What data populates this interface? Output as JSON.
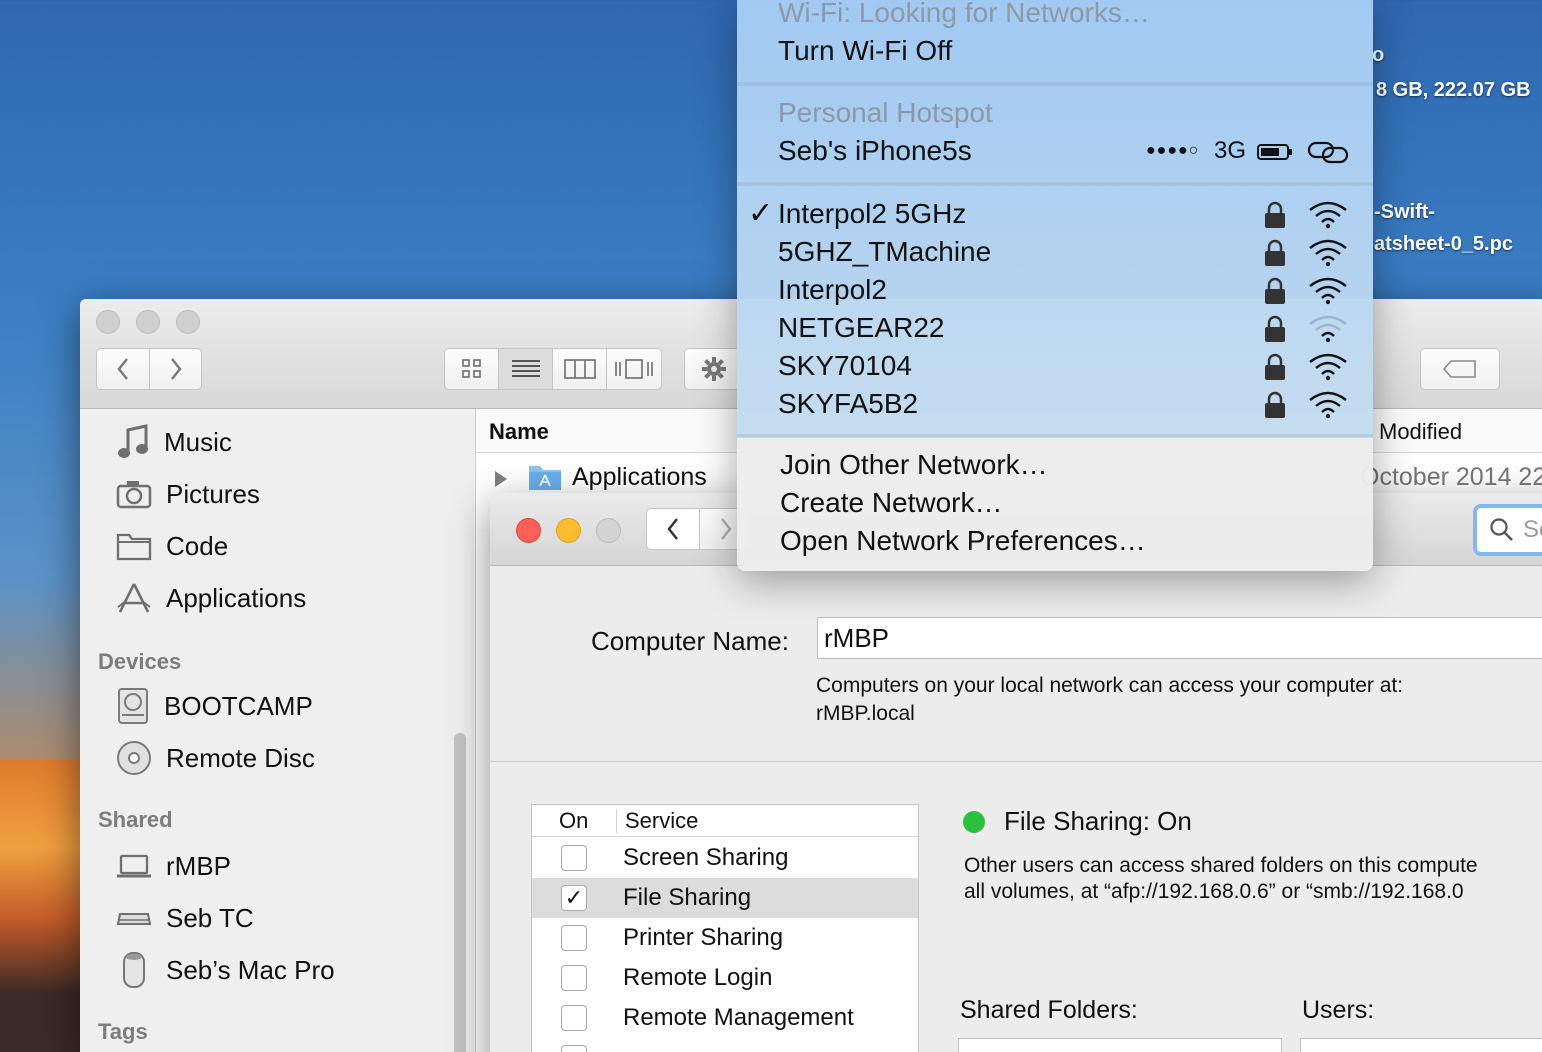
{
  "desktop": {
    "drive_name_fragment": "o",
    "drive_size_fragment": "8 GB, 222.07 GB",
    "file_name_line1": "-Swift-",
    "file_name_line2": "atsheet-0_5.pc"
  },
  "finder": {
    "sidebar": {
      "favorites": [
        {
          "label": "Music",
          "icon": "music-note-icon"
        },
        {
          "label": "Pictures",
          "icon": "camera-icon"
        },
        {
          "label": "Code",
          "icon": "folder-icon"
        },
        {
          "label": "Applications",
          "icon": "applications-icon"
        }
      ],
      "devices_heading": "Devices",
      "devices": [
        {
          "label": "BOOTCAMP",
          "icon": "hard-drive-icon"
        },
        {
          "label": "Remote Disc",
          "icon": "disc-icon"
        }
      ],
      "shared_heading": "Shared",
      "shared": [
        {
          "label": "rMBP",
          "icon": "laptop-icon"
        },
        {
          "label": "Seb TC",
          "icon": "time-capsule-icon"
        },
        {
          "label": "Seb’s Mac Pro",
          "icon": "mac-pro-icon"
        }
      ],
      "tags_heading": "Tags"
    },
    "columns": {
      "name": "Name",
      "date_modified": "Modified"
    },
    "rows": [
      {
        "name": "Applications",
        "date_fragment": "October 2014 22"
      }
    ]
  },
  "sharing": {
    "search_placeholder_fragment": "Se",
    "computer_name_label": "Computer Name:",
    "computer_name_value": "rMBP",
    "access_note": "Computers on your local network can access your computer at:",
    "local_hostname": "rMBP.local",
    "services_header": {
      "on": "On",
      "service": "Service"
    },
    "services": [
      {
        "label": "Screen Sharing",
        "checked": false,
        "selected": false
      },
      {
        "label": "File Sharing",
        "checked": true,
        "selected": true
      },
      {
        "label": "Printer Sharing",
        "checked": false,
        "selected": false
      },
      {
        "label": "Remote Login",
        "checked": false,
        "selected": false
      },
      {
        "label": "Remote Management",
        "checked": false,
        "selected": false
      }
    ],
    "checkmark": "✓",
    "status_title": "File Sharing: On",
    "status_color": "#2cc13c",
    "status_desc_line1": "Other users can access shared folders on this compute",
    "status_desc_line2": "all volumes, at “afp://192.168.0.6” or “smb://192.168.0",
    "shared_folders_label": "Shared Folders:",
    "users_label": "Users:"
  },
  "wifi_menu": {
    "status": "Wi-Fi: Looking for Networks…",
    "toggle": "Turn Wi-Fi Off",
    "hotspot_heading": "Personal Hotspot",
    "hotspot_device": "Seb's iPhone5s",
    "hotspot_signal": "●●●●○",
    "hotspot_network_type": "3G",
    "check_glyph": "✓",
    "networks": [
      {
        "name": "Interpol2 5GHz",
        "connected": true,
        "secured": true,
        "signal": 3
      },
      {
        "name": "5GHZ_TMachine",
        "connected": false,
        "secured": true,
        "signal": 3
      },
      {
        "name": "Interpol2",
        "connected": false,
        "secured": true,
        "signal": 3
      },
      {
        "name": "NETGEAR22",
        "connected": false,
        "secured": true,
        "signal": 1
      },
      {
        "name": "SKY70104",
        "connected": false,
        "secured": true,
        "signal": 3
      },
      {
        "name": "SKYFA5B2",
        "connected": false,
        "secured": true,
        "signal": 3
      }
    ],
    "actions": [
      "Join Other Network…",
      "Create Network…",
      "Open Network Preferences…"
    ]
  }
}
